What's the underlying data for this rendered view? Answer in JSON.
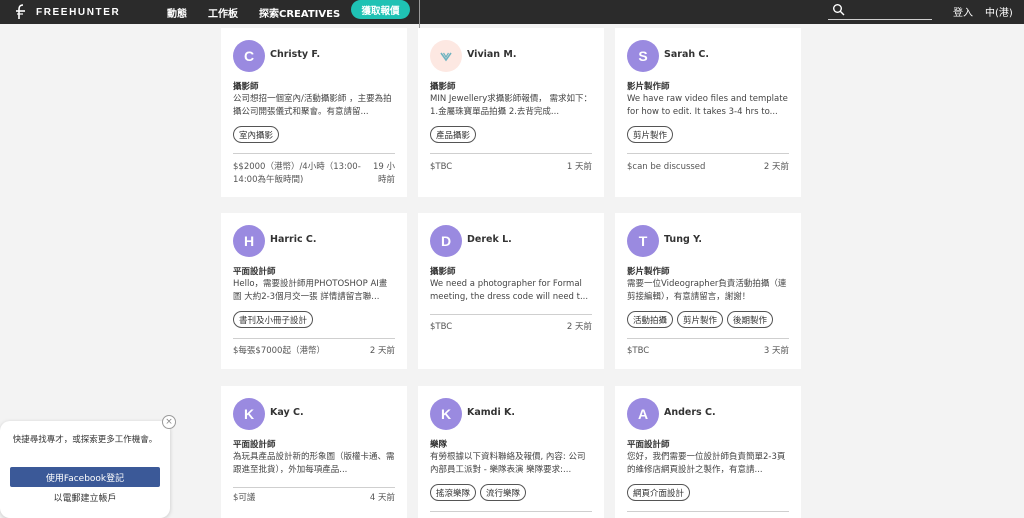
{
  "header": {
    "logo_text": "FREEHUNTER",
    "nav": {
      "activity": "動態",
      "workbench": "工作板",
      "explore": "探索CREATIVES"
    },
    "cta": "獲取報價",
    "search": {
      "placeholder": ""
    },
    "login": "登入",
    "language": "中(港)"
  },
  "colors": {
    "accent": "#1fc2b4",
    "avatar": "#9a8ae0",
    "facebook": "#3b5998",
    "header_bg": "#2b2b2b"
  },
  "cards": [
    {
      "initial": "C",
      "name": "Christy F.",
      "role": "攝影師",
      "desc": "公司想招一個室內/活動攝影師 ，主要為拍攝公司開張儀式和聚會。有意請留...",
      "tags": [
        "室內攝影"
      ],
      "price": "$$2000（港幣）/4小時（13:00-14:00為午飯時間)",
      "time": "19 小時前"
    },
    {
      "initial": "",
      "name": "Vivian M.",
      "role": "攝影師",
      "desc": "MIN Jewellery求攝影師報價， 需求如下： 1.金屬珠寶單品拍攝 2.去背完成...",
      "tags": [
        "產品攝影"
      ],
      "price": "$TBC",
      "time": "1 天前"
    },
    {
      "initial": "S",
      "name": "Sarah C.",
      "role": "影片製作師",
      "desc": "We have raw video files and template for how to edit. It takes 3-4 hrs to...",
      "tags": [
        "剪片製作"
      ],
      "price": "$can be discussed",
      "time": "2 天前"
    },
    {
      "initial": "H",
      "name": "Harric C.",
      "role": "平面設計師",
      "desc": "Hello，需要設計師用PHOTOSHOP AI畫圖 大約2-3個月交一張 詳情請留言聯...",
      "tags": [
        "書刊及小冊子設計"
      ],
      "price": "$每張$7000起（港幣）",
      "time": "2 天前"
    },
    {
      "initial": "D",
      "name": "Derek L.",
      "role": "攝影師",
      "desc": "We need a photographer for Formal meeting, the dress code will need t...",
      "tags": [],
      "price": "$TBC",
      "time": "2 天前"
    },
    {
      "initial": "T",
      "name": "Tung Y.",
      "role": "影片製作師",
      "desc": "需要一位Videographer負責活動拍攝（連剪接編輯），有意請留言，謝謝！",
      "tags": [
        "活動拍攝",
        "剪片製作",
        "後期製作"
      ],
      "price": "$TBC",
      "time": "3 天前"
    },
    {
      "initial": "K",
      "name": "Kay C.",
      "role": "平面設計師",
      "desc": "為玩具產品設計新的形象圖（版權卡通、需跟進至批貨），外加每項產品...",
      "tags": [],
      "price": "$可議",
      "time": "4 天前"
    },
    {
      "initial": "K",
      "name": "Kamdi K.",
      "role": "樂隊",
      "desc": "有勞根據以下資料聯絡及報價, 內容: 公司內部員工派對 - 樂隊表演 樂隊要求:...",
      "tags": [
        "搖滾樂隊",
        "流行樂隊"
      ],
      "price": "",
      "time": ""
    },
    {
      "initial": "A",
      "name": "Anders C.",
      "role": "平面設計師",
      "desc": "您好，我們需要一位設計師負責簡單2-3頁的維修店網頁設計之製作，有意請...",
      "tags": [
        "網頁介面設計"
      ],
      "price": "",
      "time": ""
    }
  ],
  "popup": {
    "text": "快捷尋找專才，或探索更多工作機會。",
    "facebook_button": "使用Facebook登記",
    "email_link": "以電郵建立帳戶",
    "close": "×"
  }
}
